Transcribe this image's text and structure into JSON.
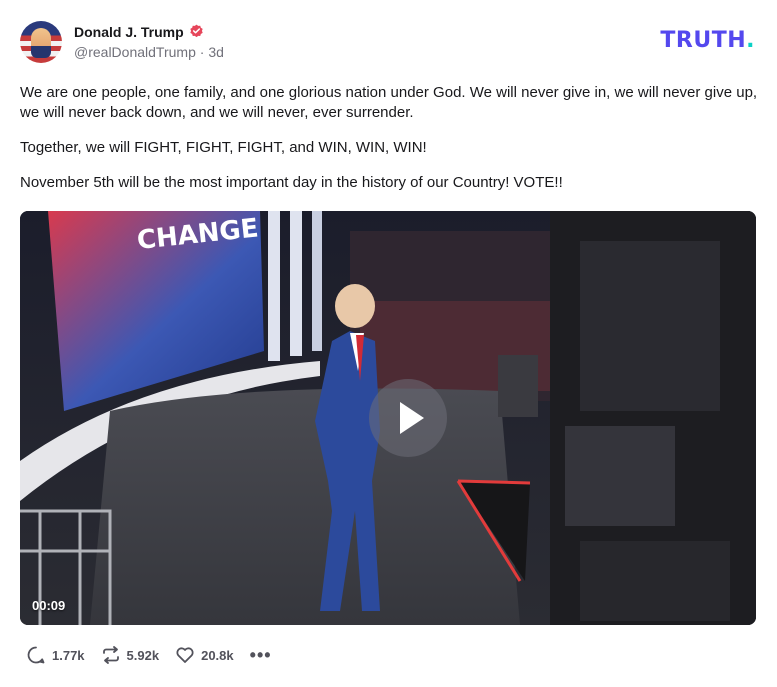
{
  "author": {
    "display_name": "Donald J. Trump",
    "handle": "@realDonaldTrump",
    "separator": "·",
    "time_ago": "3d"
  },
  "brand": {
    "logo_text": "TRUTH",
    "logo_dot": ".",
    "logo_color": "#5448ee",
    "dot_color": "#0bd1c6"
  },
  "post": {
    "paragraphs": [
      "We are one people, one family, and one glorious nation under God. We will never give in, we will never give up, we will never back down, and we will never, ever surrender.",
      "Together, we will FIGHT, FIGHT, FIGHT, and WIN, WIN, WIN!",
      "November 5th will be the most important day in the history of our Country! VOTE!!"
    ]
  },
  "video": {
    "duration": "00:09",
    "screen_text": "CHANGE"
  },
  "actions": {
    "replies": "1.77k",
    "retruths": "5.92k",
    "likes": "20.8k",
    "more": "•••"
  },
  "icons": [
    "verified-badge-icon",
    "reply-icon",
    "retruth-icon",
    "like-icon",
    "more-icon",
    "play-icon"
  ]
}
